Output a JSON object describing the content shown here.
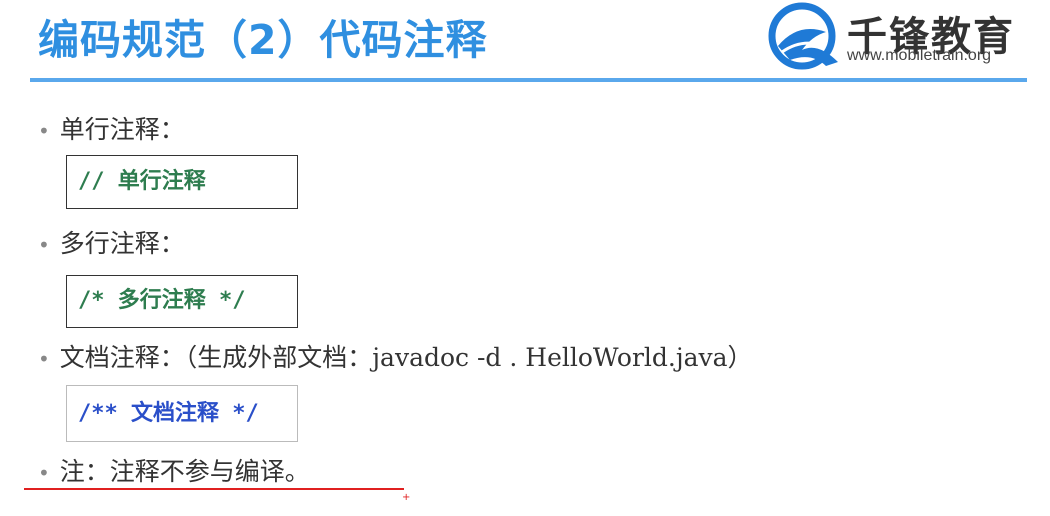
{
  "slide": {
    "title": "编码规范（2）代码注释"
  },
  "brand": {
    "name": "千锋教育",
    "url": "www.mobiletrain.org"
  },
  "items": [
    {
      "bullet": "•",
      "label": "单行注释：",
      "code": "// 单行注释"
    },
    {
      "bullet": "•",
      "label": "多行注释：",
      "code": "/* 多行注释 */"
    },
    {
      "bullet": "•",
      "label": "文档注释：（生成外部文档：javadoc -d . HelloWorld.java）",
      "code": "/** 文档注释 */"
    },
    {
      "bullet": "•",
      "label": "注：注释不参与编译。"
    }
  ],
  "colors": {
    "title": "#2f8fe0",
    "rule": "#5aa8ec",
    "single_comment": "#2e7d4f",
    "multi_comment": "#2e7d4f",
    "doc_comment": "#2a4fc9",
    "annotation": "#e02020"
  }
}
